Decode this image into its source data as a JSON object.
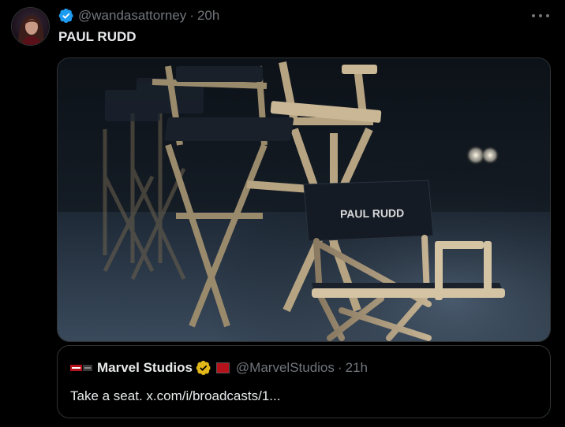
{
  "post": {
    "handle": "@wandasattorney",
    "separator": "·",
    "time": "20h",
    "text": "PAUL RUDD",
    "chair_label": "PAUL RUDD"
  },
  "quote": {
    "name": "Marvel Studios",
    "handle": "@MarvelStudios",
    "separator": "·",
    "time": "21h",
    "text": "Take a seat. x.com/i/broadcasts/1..."
  },
  "colors": {
    "background": "#000000",
    "text": "#e7e9ea",
    "muted": "#71767b",
    "verified_blue": "#1d9bf0",
    "verified_gold": "#e2b719",
    "marvel_red": "#b5121b"
  },
  "icons": {
    "verified": "verified-badge-icon",
    "more": "more-dots-icon",
    "business_verified": "gold-verified-badge-icon"
  }
}
